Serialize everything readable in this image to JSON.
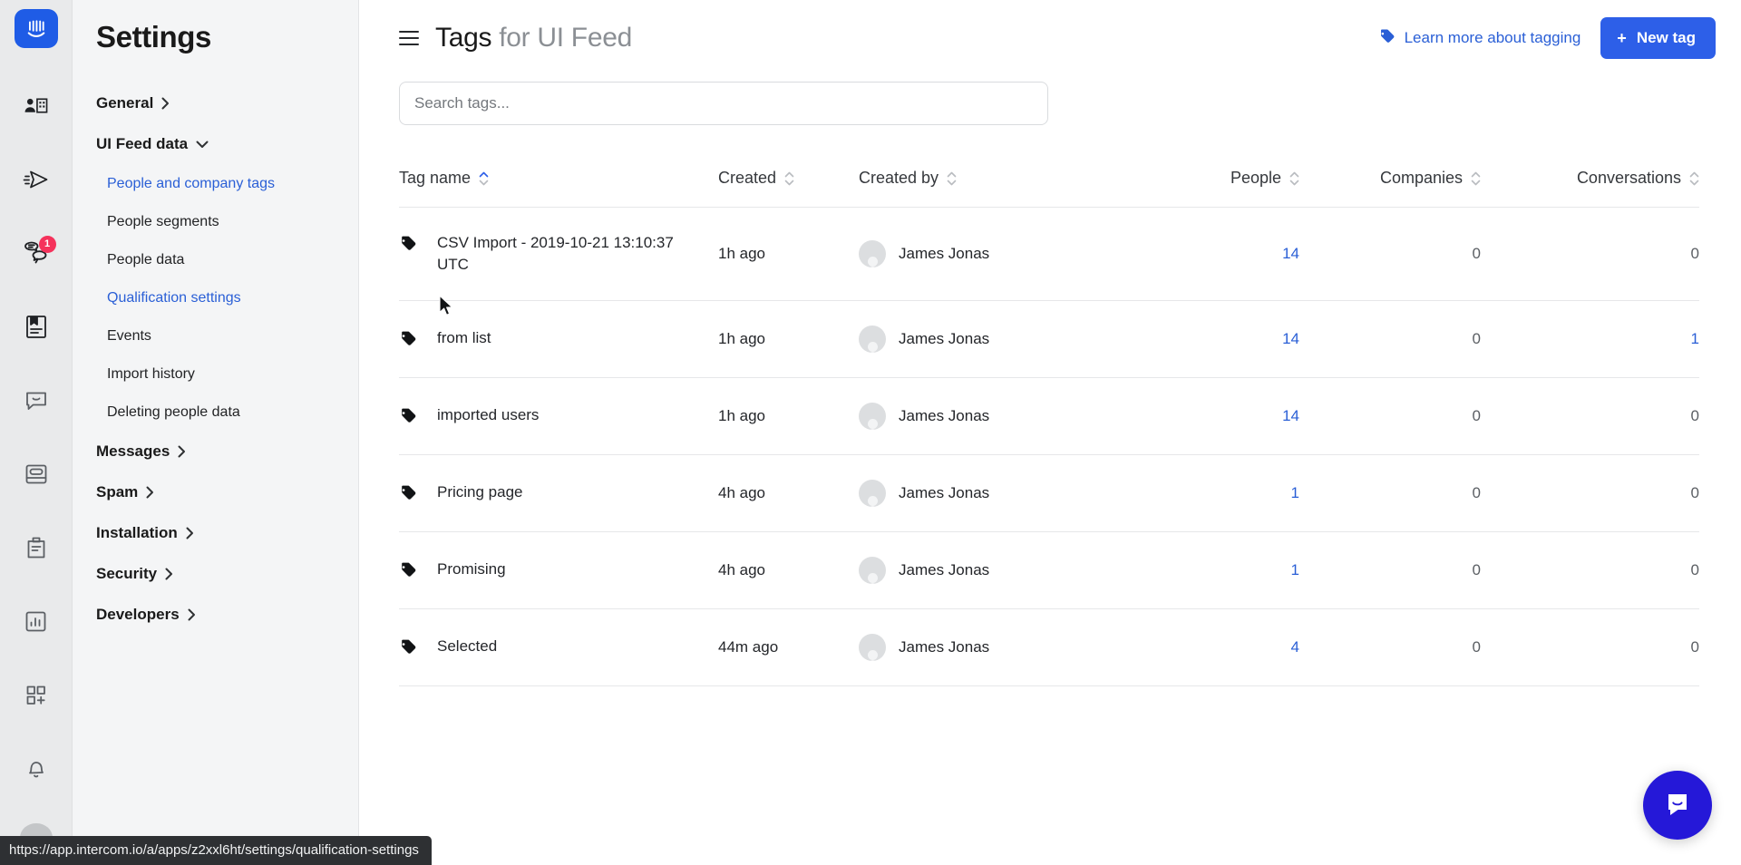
{
  "rail": {
    "logo_icon": "intercom-logo-icon",
    "items": [
      {
        "icon": "contacts-icon",
        "badge": null
      },
      {
        "icon": "send-outbound-icon",
        "badge": null
      },
      {
        "icon": "inbox-conversations-icon",
        "badge": "1"
      },
      {
        "icon": "articles-icon",
        "badge": null
      },
      {
        "icon": "messenger-chat-icon",
        "badge": null
      },
      {
        "icon": "product-tours-icon",
        "badge": null
      },
      {
        "icon": "surveys-clipboard-icon",
        "badge": null
      },
      {
        "icon": "reports-bar-chart-icon",
        "badge": null
      },
      {
        "icon": "app-store-plus-icon",
        "badge": null
      },
      {
        "icon": "notifications-bell-icon",
        "badge": null
      }
    ],
    "avatar": "user-avatar"
  },
  "settings": {
    "title": "Settings",
    "nav": [
      {
        "label": "General",
        "type": "group",
        "chevron": "right",
        "state": "collapsed"
      },
      {
        "label": "UI Feed data",
        "type": "group",
        "chevron": "down",
        "state": "expanded"
      },
      {
        "label": "People and company tags",
        "type": "child",
        "state": "active"
      },
      {
        "label": "People segments",
        "type": "child",
        "state": "normal"
      },
      {
        "label": "People data",
        "type": "child",
        "state": "normal"
      },
      {
        "label": "Qualification settings",
        "type": "child",
        "state": "link"
      },
      {
        "label": "Events",
        "type": "child",
        "state": "normal"
      },
      {
        "label": "Import history",
        "type": "child",
        "state": "normal"
      },
      {
        "label": "Deleting people data",
        "type": "child",
        "state": "normal"
      },
      {
        "label": "Messages",
        "type": "group",
        "chevron": "right",
        "state": "collapsed"
      },
      {
        "label": "Spam",
        "type": "group",
        "chevron": "right",
        "state": "collapsed"
      },
      {
        "label": "Installation",
        "type": "group",
        "chevron": "right",
        "state": "collapsed"
      },
      {
        "label": "Security",
        "type": "group",
        "chevron": "right",
        "state": "collapsed"
      },
      {
        "label": "Developers",
        "type": "group",
        "chevron": "right",
        "state": "collapsed"
      }
    ]
  },
  "header": {
    "menu_icon": "hamburger-menu-icon",
    "title_main": "Tags",
    "title_muted": "for UI Feed",
    "learn_link": "Learn more about tagging",
    "learn_icon": "tag-icon",
    "new_tag_button": "New tag",
    "new_tag_plus": "+"
  },
  "search": {
    "placeholder": "Search tags...",
    "value": ""
  },
  "table": {
    "columns": [
      {
        "label": "Tag name",
        "sort": "asc",
        "align": "left"
      },
      {
        "label": "Created",
        "sort": "none",
        "align": "left"
      },
      {
        "label": "Created by",
        "sort": "none",
        "align": "left"
      },
      {
        "label": "People",
        "sort": "none",
        "align": "right"
      },
      {
        "label": "Companies",
        "sort": "none",
        "align": "right"
      },
      {
        "label": "Conversations",
        "sort": "none",
        "align": "right"
      }
    ],
    "rows": [
      {
        "name": "CSV Import - 2019-10-21 13:10:37 UTC",
        "created": "1h ago",
        "created_by": "James Jonas",
        "people": "14",
        "companies": "0",
        "conversations": "0"
      },
      {
        "name": "from list",
        "created": "1h ago",
        "created_by": "James Jonas",
        "people": "14",
        "companies": "0",
        "conversations": "1"
      },
      {
        "name": "imported users",
        "created": "1h ago",
        "created_by": "James Jonas",
        "people": "14",
        "companies": "0",
        "conversations": "0"
      },
      {
        "name": "Pricing page",
        "created": "4h ago",
        "created_by": "James Jonas",
        "people": "1",
        "companies": "0",
        "conversations": "0"
      },
      {
        "name": "Promising",
        "created": "4h ago",
        "created_by": "James Jonas",
        "people": "1",
        "companies": "0",
        "conversations": "0"
      },
      {
        "name": "Selected",
        "created": "44m ago",
        "created_by": "James Jonas",
        "people": "4",
        "companies": "0",
        "conversations": "0"
      }
    ]
  },
  "messenger": {
    "icon": "messenger-launcher-icon"
  },
  "statusbar": {
    "url": "https://app.intercom.io/a/apps/z2xxl6ht/settings/qualification-settings"
  },
  "colors": {
    "accent_blue": "#2d5fe8",
    "link_blue": "#2a5fd6",
    "badge_red": "#f5325b",
    "messenger_blue": "#2518d8",
    "rail_bg": "#e9eaeb",
    "nav_bg": "#f4f5f6"
  }
}
